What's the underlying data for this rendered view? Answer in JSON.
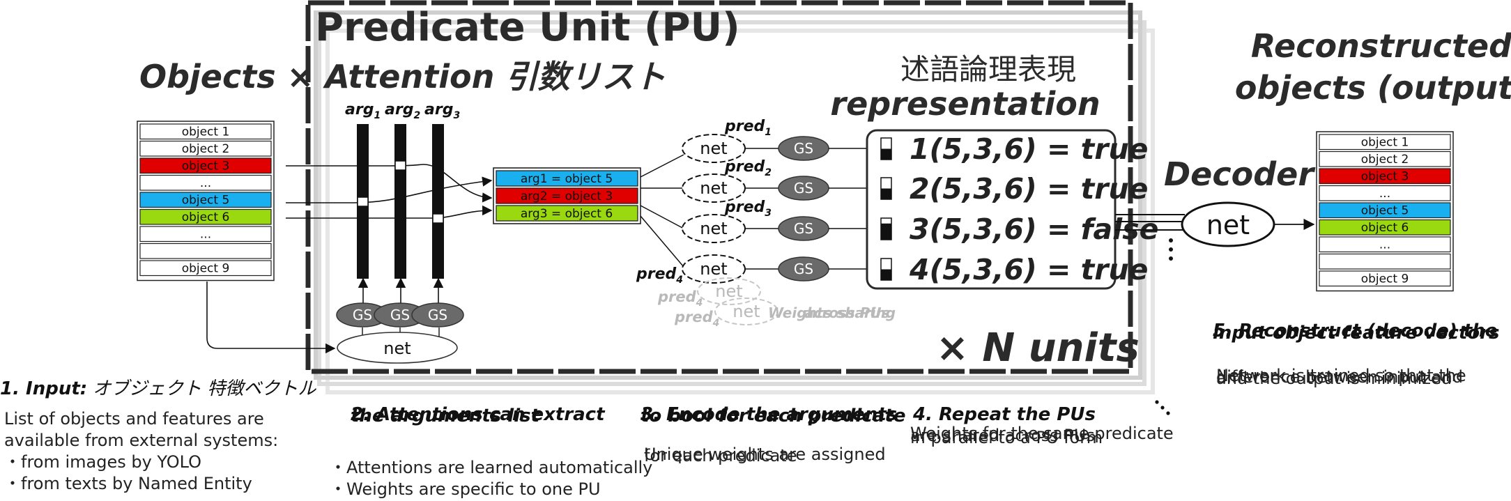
{
  "colors": {
    "red": "#e00000",
    "blue": "#1ab0f0",
    "green": "#9ad80f",
    "dark": "#2b2b2b",
    "gs": "#6a6a6a",
    "ghost": "#bdbdbd"
  },
  "pu_title": "Predicate Unit (PU)",
  "objects_heading": "Objects × Attention 引数リスト",
  "input_list": [
    "object 1",
    "object 2",
    "object 3",
    "...",
    "object 5",
    "object 6",
    "...",
    "",
    "object 9"
  ],
  "arg_labels": [
    "arg",
    "arg",
    "arg"
  ],
  "arg_subs": [
    "1",
    "2",
    "3"
  ],
  "gs_label": "GS",
  "net_label": "net",
  "arg_assign": [
    "arg1 = object 5",
    "arg2 = object 3",
    "arg3 = object 6"
  ],
  "pred_label": "pred",
  "pred_subs": [
    "1",
    "2",
    "3",
    "4"
  ],
  "ghost": {
    "pred_sub": "4",
    "text_a": "Weights sharing",
    "text_b": "across PUs"
  },
  "logic_heading_ja": "述語論理表現",
  "logic_heading_en": "representation",
  "predicates": [
    "1(5,3,6) = true",
    "2(5,3,6) = true",
    "3(5,3,6) = false",
    "4(5,3,6) = true"
  ],
  "units_label": "× N units",
  "decoder_label": "Decoder",
  "output_heading": [
    "Reconstructed",
    "objects (output)"
  ],
  "output_list": [
    "object 1",
    "object 2",
    "object 3",
    "...",
    "object 5",
    "object 6",
    "...",
    "",
    "object 9"
  ],
  "step1": {
    "title": "1. Input:",
    "title_ja": "オブジェクト 特徴ベクトル",
    "body": [
      "List of objects and features are",
      "available from external systems:",
      "・from images by YOLO",
      "・from texts by Named Entity"
    ]
  },
  "step2": {
    "title_a": "2. Attentions can extract",
    "title_b": "the arguments list",
    "body": [
      "・Attentions are learned automatically",
      "・Weights are specific to one PU"
    ]
  },
  "step3": {
    "title_a": "3. Encode the arguments",
    "title_b": "to bool for each predicate",
    "body_a": "Unique weights are assigned",
    "body_b": "for each predicate"
  },
  "step4": {
    "title": "4. Repeat the PUs",
    "body_a": "Weights for the same predicate",
    "body_b": "are shared across PUs",
    "body_c": "in parallel to a PU form"
  },
  "step5": {
    "title_a": "5. Reconstruct (decode) the",
    "title_b": "input object feature vectors",
    "body_a": "Network is trained so that the",
    "body_b": "difference between input and",
    "body_c": "and the output is minimized"
  }
}
